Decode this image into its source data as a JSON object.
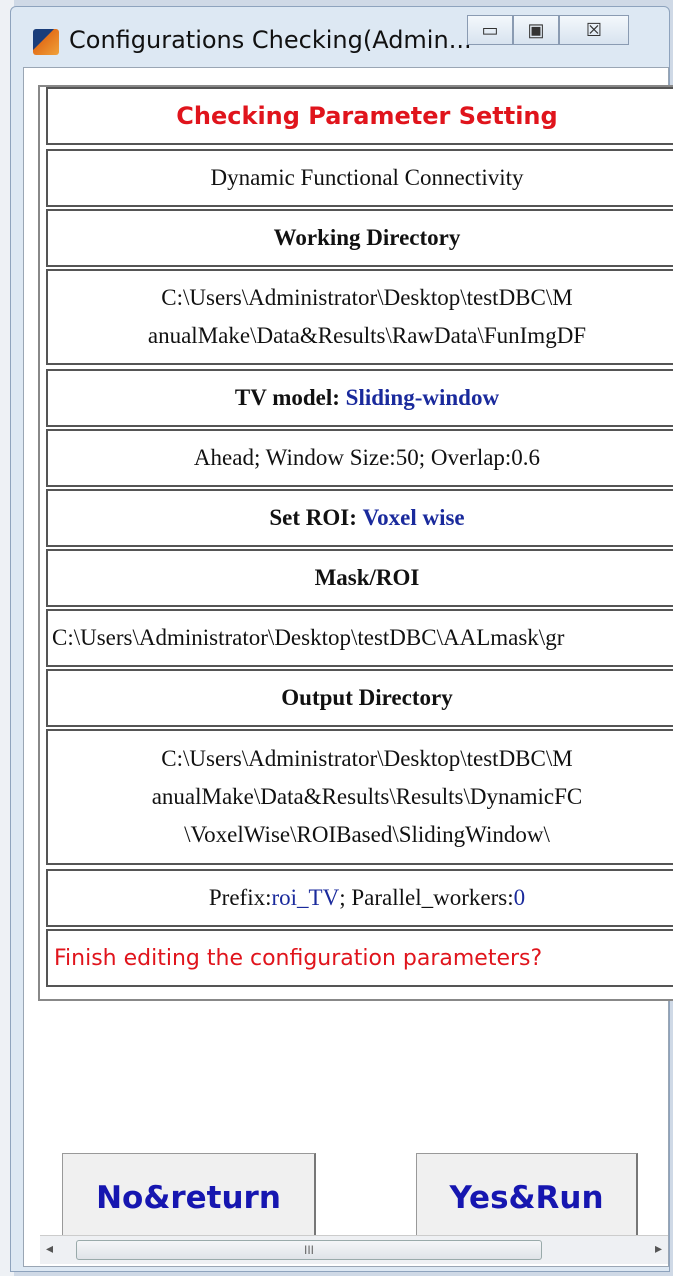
{
  "window": {
    "title": "Configurations Checking(Admin...",
    "controls": {
      "minimize": "▭",
      "maximize": "▣",
      "close": "☒"
    }
  },
  "rows": {
    "heading": "Checking Parameter Setting",
    "analysis_type": "Dynamic Functional Connectivity",
    "working_dir_label": "Working Directory",
    "working_dir_line1": "C:\\Users\\Administrator\\Desktop\\testDBC\\M",
    "working_dir_line2": "anualMake\\Data&Results\\RawData\\FunImgDF",
    "tv_model_label": "TV model:",
    "tv_model_value": "Sliding-window",
    "tv_params": "Ahead; Window Size:50; Overlap:0.6",
    "roi_label": "Set ROI:",
    "roi_value": "Voxel wise",
    "mask_label": "Mask/ROI",
    "mask_path": "C:\\Users\\Administrator\\Desktop\\testDBC\\AALmask\\gr",
    "output_dir_label": "Output Directory",
    "output_dir_line1": "C:\\Users\\Administrator\\Desktop\\testDBC\\M",
    "output_dir_line2": "anualMake\\Data&Results\\Results\\DynamicFC",
    "output_dir_line3": "\\VoxelWise\\ROIBased\\SlidingWindow\\",
    "prefix_label": "Prefix:",
    "prefix_value": "roi_TV",
    "workers_label": " ; Parallel_workers:",
    "workers_value": "0",
    "confirm_message": "Finish editing the configuration parameters?"
  },
  "buttons": {
    "no_return": "No&return",
    "yes_run": "Yes&Run"
  },
  "scrollbar": {
    "left_arrow": "◂",
    "right_arrow": "▸",
    "grip": "III"
  }
}
